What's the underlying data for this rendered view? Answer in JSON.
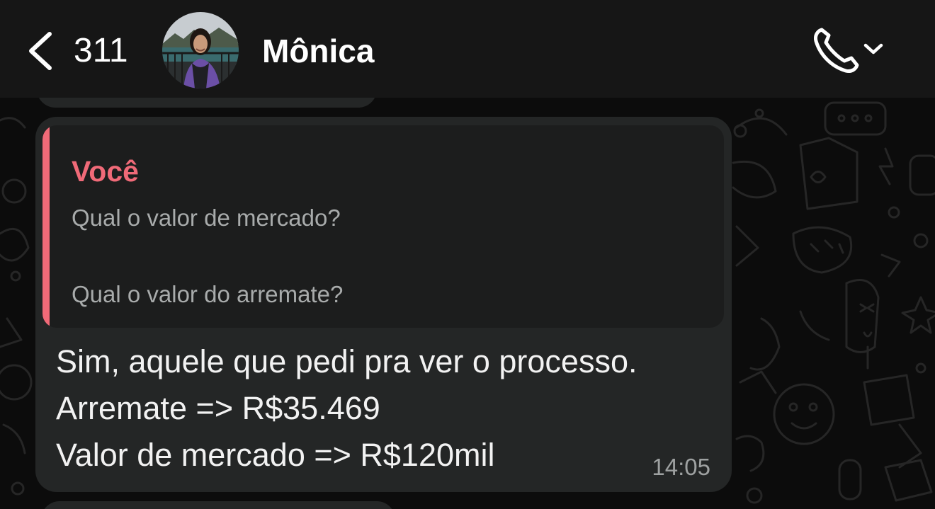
{
  "header": {
    "unread_count": "311",
    "contact_name": "Mônica",
    "back_icon": "chevron-left-icon",
    "call_icon": "phone-icon",
    "dropdown_icon": "chevron-down-icon"
  },
  "message": {
    "quote": {
      "author": "Você",
      "lines": [
        "Qual o valor de mercado?",
        "Qual o valor do arremate?"
      ]
    },
    "lines": [
      "Sim, aquele que pedi pra ver o processo.",
      "Arremate => R$35.469",
      "Valor de mercado => R$120mil"
    ],
    "time": "14:05"
  },
  "colors": {
    "header_bg": "#161616",
    "bubble_bg": "#242626",
    "quote_bg": "#1c1d1d",
    "quote_accent": "#f06a78",
    "text": "#f2f2f2",
    "muted_text": "#a8abab"
  }
}
